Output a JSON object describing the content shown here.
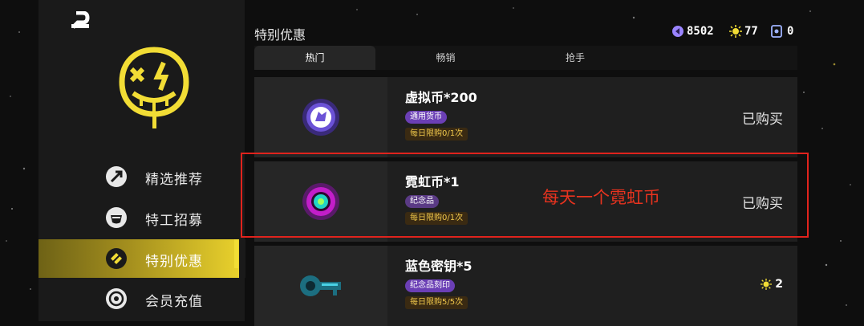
{
  "section_title": "特别优惠",
  "currency": {
    "gems": "8502",
    "sun": "77",
    "tokens": "0"
  },
  "tabs": [
    {
      "label": "热门",
      "active": true
    },
    {
      "label": "畅销",
      "active": false
    },
    {
      "label": "抢手",
      "active": false
    }
  ],
  "sidebar": {
    "items": [
      {
        "label": "精选推荐",
        "icon": "featured-icon"
      },
      {
        "label": "特工招募",
        "icon": "agent-icon"
      },
      {
        "label": "特别优惠",
        "icon": "special-offer-icon",
        "active": true
      },
      {
        "label": "会员充值",
        "icon": "membership-icon"
      }
    ]
  },
  "items": [
    {
      "name": "虚拟币*200",
      "tag": "通用货币",
      "limit": "每日限购0/1次",
      "status": "已购买",
      "icon": "virtual-coin-icon"
    },
    {
      "name": "霓虹币*1",
      "tag": "纪念品",
      "limit": "每日限购0/1次",
      "status": "已购买",
      "icon": "neon-coin-icon"
    },
    {
      "name": "蓝色密钥*5",
      "tag": "纪念品刻印",
      "limit": "每日限购5/5次",
      "price": "2",
      "icon": "blue-key-icon"
    }
  ],
  "annotation": "每天一个霓虹币",
  "colors": {
    "accent": "#f2dd35",
    "highlight": "#e0231d",
    "tag_purple": "#6b3fb5"
  }
}
